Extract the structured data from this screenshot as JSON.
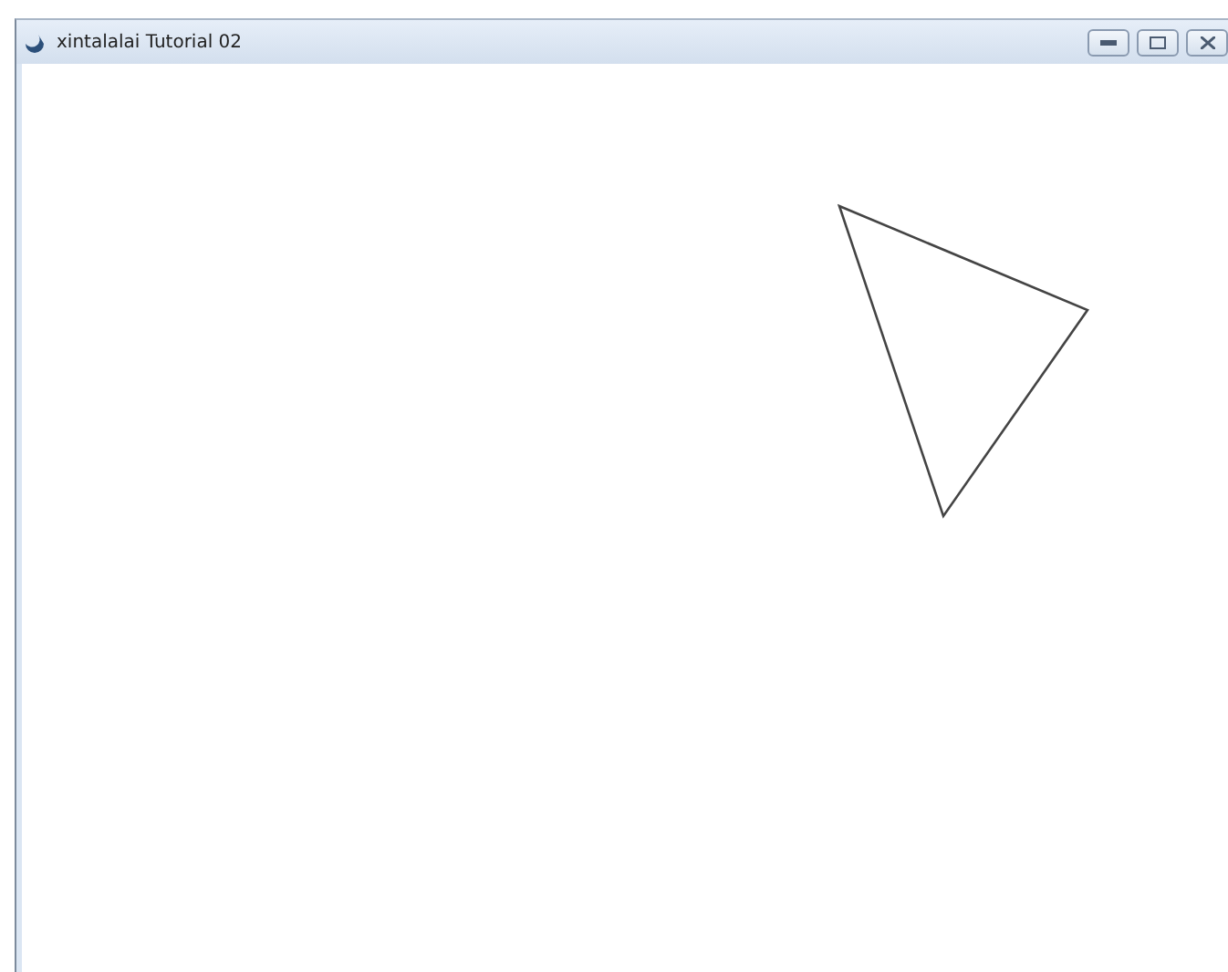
{
  "window": {
    "title": "xintalalai Tutorial 02"
  }
}
